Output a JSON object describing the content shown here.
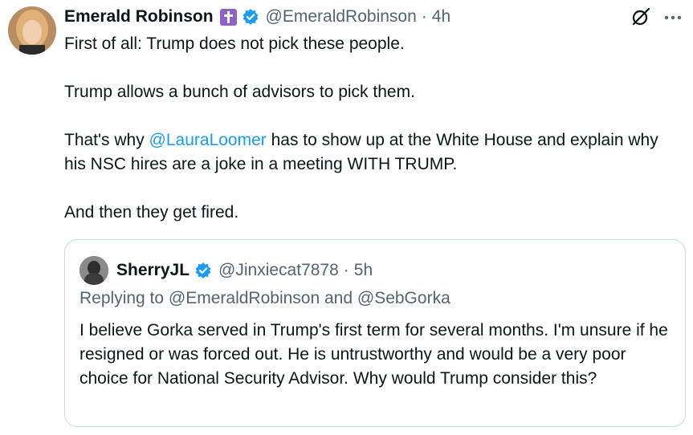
{
  "author": {
    "name": "Emerald Robinson",
    "handle": "@EmeraldRobinson",
    "separator": "·",
    "time": "4h"
  },
  "icons": {
    "affiliation": "cross-badge-icon",
    "verified": "verified-badge-icon",
    "grok": "grok-icon",
    "more": "more-options-icon"
  },
  "tweet": {
    "line1": "First of all: Trump does not pick these people.",
    "line2": "Trump allows a bunch of advisors to pick them.",
    "line3_before": "That's why ",
    "line3_mention": "@LauraLoomer",
    "line3_after": " has to show up at the White House and explain why his NSC hires are a joke in a meeting WITH TRUMP.",
    "line4": "And then they get fired."
  },
  "quote": {
    "name": "SherryJL",
    "handle": "@Jinxiecat7878",
    "separator": "·",
    "time": "5h",
    "replying_prefix": "Replying to ",
    "replying_to_1": "@EmeraldRobinson",
    "replying_and": " and ",
    "replying_to_2": "@SebGorka",
    "text": "I believe Gorka served in Trump's first term for several months. I'm unsure if he resigned or was forced out. He is untrustworthy and would be a very poor choice for National Security Advisor. Why would Trump consider this?"
  },
  "colors": {
    "accent": "#1d9bf0",
    "secondary_text": "#536471",
    "badge_purple": "#8e62c6"
  }
}
